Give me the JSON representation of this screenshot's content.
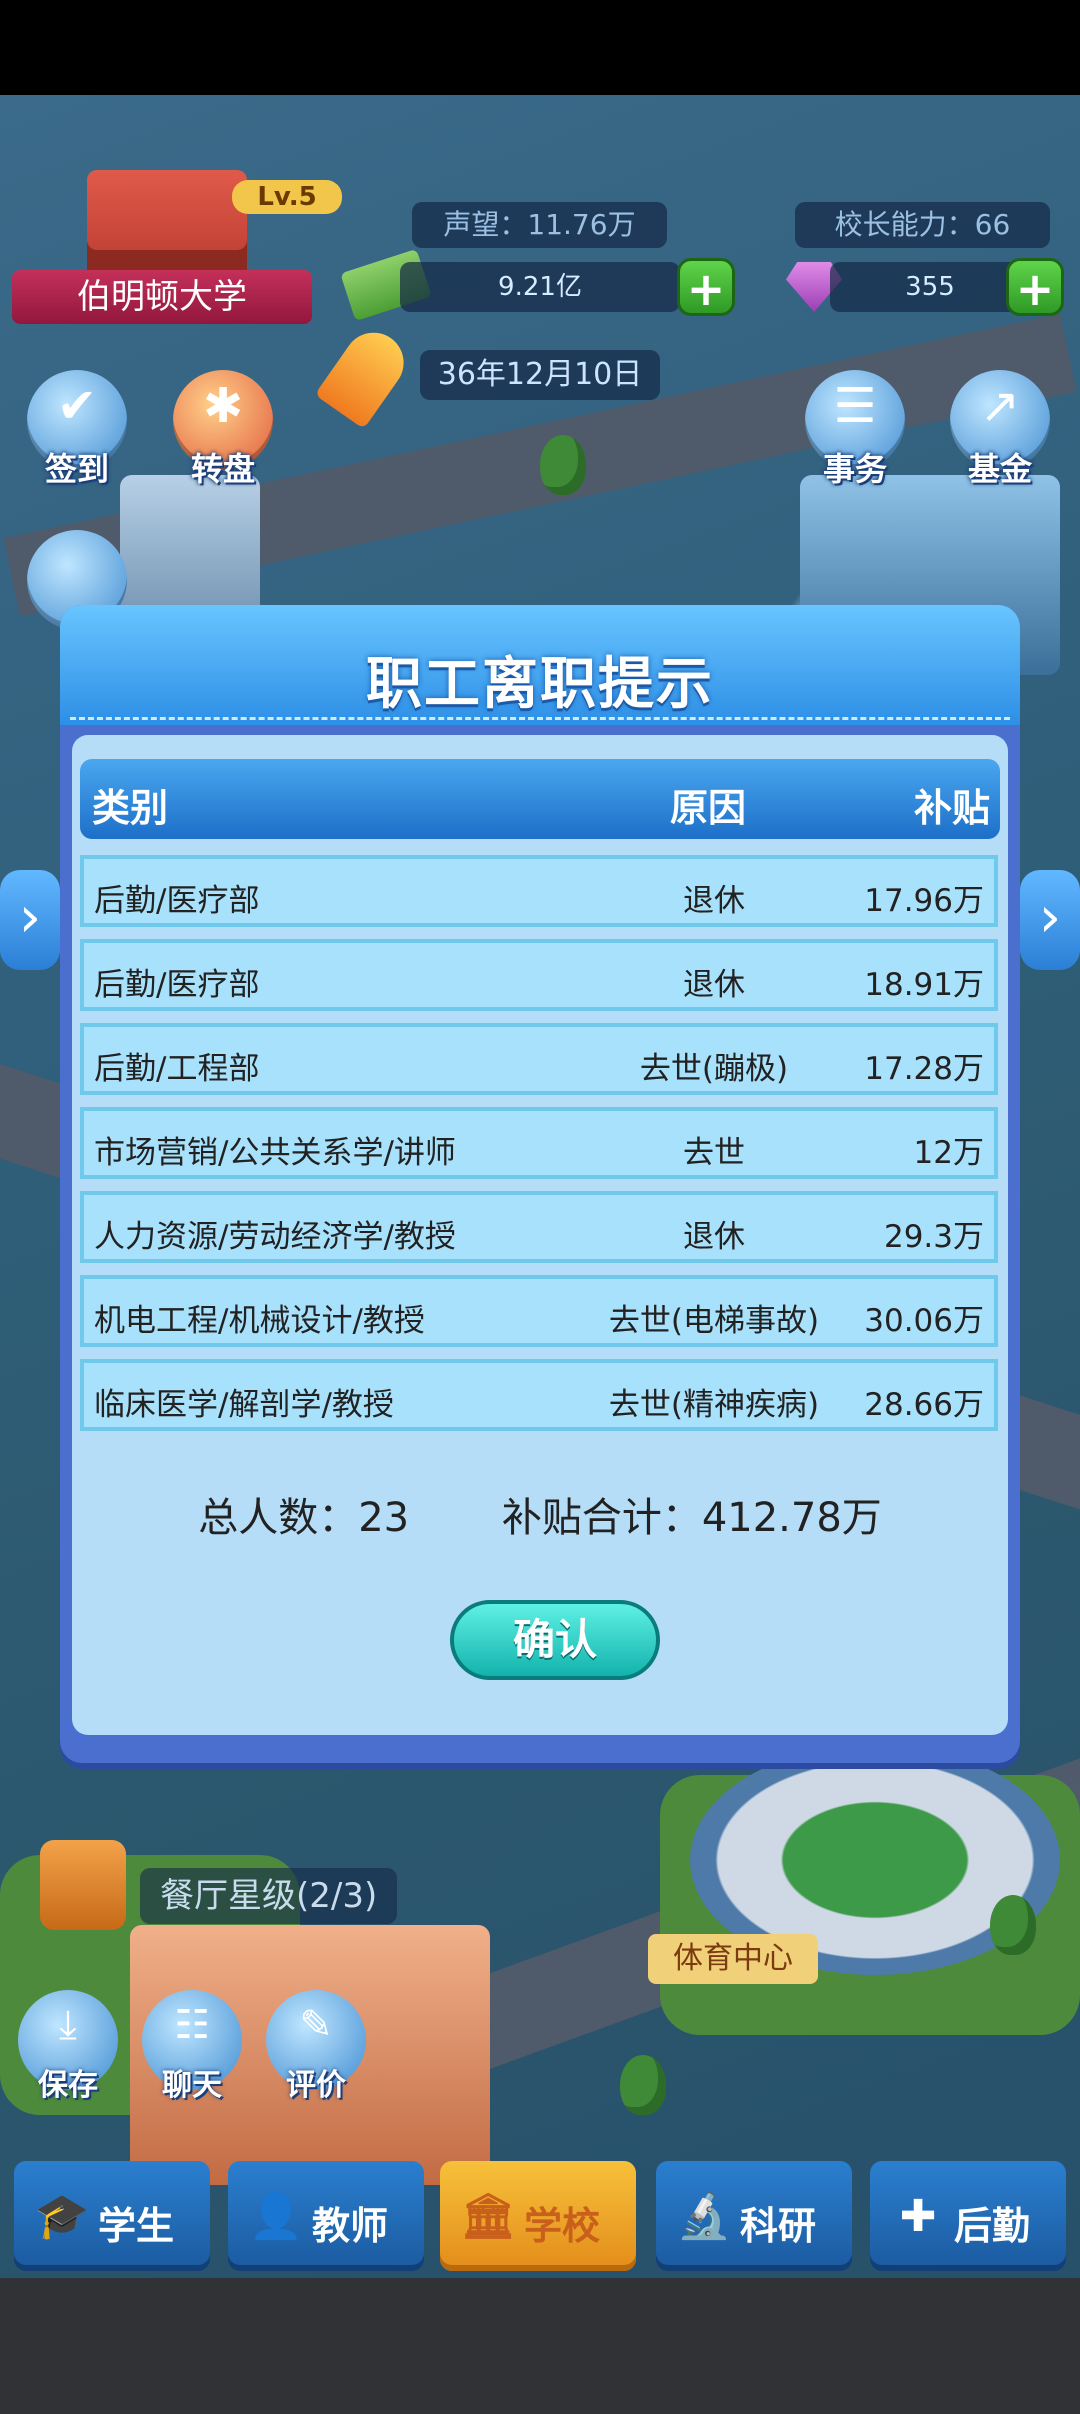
{
  "hud": {
    "school_name": "伯明顿大学",
    "level": "Lv.5",
    "reputation": "声望：11.76万",
    "principal_ability": "校长能力：66",
    "money": "9.21亿",
    "gems": "355",
    "date": "36年12月10日"
  },
  "left_buttons": [
    {
      "label": "签到",
      "icon": "calendar-check-icon"
    },
    {
      "label": "转盘",
      "icon": "wheel-icon"
    }
  ],
  "right_buttons": [
    {
      "label": "事务",
      "icon": "clipboard-icon"
    },
    {
      "label": "基金",
      "icon": "chart-up-icon"
    }
  ],
  "modal": {
    "title": "职工离职提示",
    "headers": {
      "category": "类别",
      "reason": "原因",
      "subsidy": "补贴"
    },
    "rows": [
      {
        "category": "后勤/医疗部",
        "reason": "退休",
        "subsidy": "17.96万"
      },
      {
        "category": "后勤/医疗部",
        "reason": "退休",
        "subsidy": "18.91万"
      },
      {
        "category": "后勤/工程部",
        "reason": "去世(蹦极)",
        "subsidy": "17.28万"
      },
      {
        "category": "市场营销/公共关系学/讲师",
        "reason": "去世",
        "subsidy": "12万"
      },
      {
        "category": "人力资源/劳动经济学/教授",
        "reason": "退休",
        "subsidy": "29.3万"
      },
      {
        "category": "机电工程/机械设计/教授",
        "reason": "去世(电梯事故)",
        "subsidy": "30.06万"
      },
      {
        "category": "临床医学/解剖学/教授",
        "reason": "去世(精神疾病)",
        "subsidy": "28.66万"
      }
    ],
    "total_people": "总人数：23",
    "total_subsidy": "补贴合计：412.78万",
    "confirm_label": "确认"
  },
  "world": {
    "restaurant_rating": "餐厅星级(2/3)",
    "sports_center": "体育中心"
  },
  "bottom_left_buttons": [
    {
      "label": "保存",
      "icon": "save-icon"
    },
    {
      "label": "聊天",
      "icon": "chat-icon"
    },
    {
      "label": "评价",
      "icon": "edit-icon"
    }
  ],
  "tabs": [
    {
      "label": "学生",
      "icon": "graduation-cap-icon"
    },
    {
      "label": "教师",
      "icon": "teacher-icon"
    },
    {
      "label": "学校",
      "icon": "building-icon",
      "active": true
    },
    {
      "label": "科研",
      "icon": "microscope-icon"
    },
    {
      "label": "后勤",
      "icon": "medical-icon"
    }
  ],
  "colors": {
    "modal_header": "#2d8fe6",
    "modal_body": "#b5ddf7",
    "confirm": "#12b3ad",
    "active_tab": "#f7c13a"
  }
}
